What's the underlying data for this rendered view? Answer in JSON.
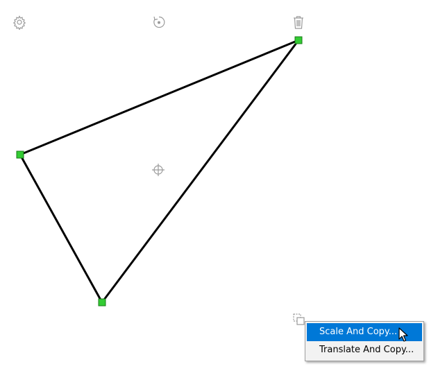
{
  "toolbar": {
    "settings_icon": "gear-icon",
    "rotate_icon": "rotate-icon",
    "delete_icon": "trash-icon",
    "center_icon": "crosshair-icon",
    "copy_icon": "copy-icon"
  },
  "shape": {
    "type": "triangle",
    "stroke_color": "#000000",
    "handle_color": "#33cc33",
    "vertices": [
      "top-right",
      "left",
      "bottom"
    ]
  },
  "context_menu": {
    "items": [
      {
        "label": "Scale And Copy...",
        "highlighted": true
      },
      {
        "label": "Translate And Copy...",
        "highlighted": false
      }
    ],
    "highlight_color": "#0078d7"
  }
}
